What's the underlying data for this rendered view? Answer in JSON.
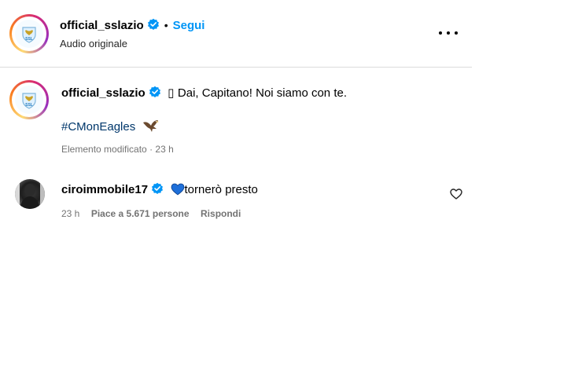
{
  "header": {
    "username": "official_sslazio",
    "separator": "•",
    "follow_label": "Segui",
    "audio_label": "Audio originale",
    "more_icon": "more-horizontal-icon"
  },
  "caption": {
    "username": "official_sslazio",
    "emoji_glyph": "▯",
    "text": "Dai, Capitano! Noi siamo con te.",
    "hashtag": "#CMonEagles",
    "hashtag_emoji": "eagle-emoji",
    "edited_label": "Elemento modificato",
    "separator": "·",
    "time": "23 h"
  },
  "comment": {
    "username": "ciroimmobile17",
    "heart_emoji": "blue-heart-emoji",
    "heart_color": "#1e6fd9",
    "text": "tornerò presto",
    "time": "23 h",
    "likes_label": "Piace a 5.671 persone",
    "reply_label": "Rispondi"
  },
  "colors": {
    "link_blue": "#0095f6",
    "hashtag_blue": "#00376b",
    "verified_blue": "#0095f6",
    "muted_text": "#737373",
    "divider": "#dbdbdb"
  }
}
